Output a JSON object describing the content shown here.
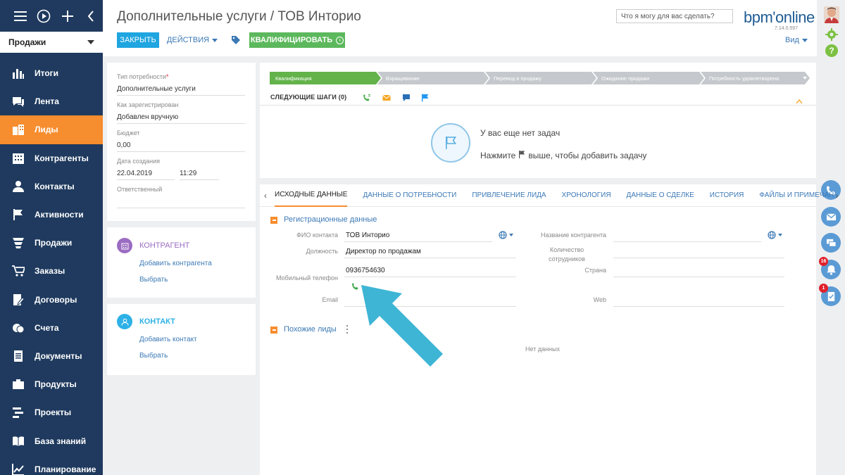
{
  "sidebar": {
    "workplace": "Продажи",
    "items": [
      {
        "label": "Итоги",
        "icon": "dashboard-icon"
      },
      {
        "label": "Лента",
        "icon": "feed-icon"
      },
      {
        "label": "Лиды",
        "icon": "leads-icon",
        "active": true
      },
      {
        "label": "Контрагенты",
        "icon": "accounts-icon"
      },
      {
        "label": "Контакты",
        "icon": "contacts-icon"
      },
      {
        "label": "Активности",
        "icon": "activities-icon"
      },
      {
        "label": "Продажи",
        "icon": "sales-icon"
      },
      {
        "label": "Заказы",
        "icon": "orders-icon"
      },
      {
        "label": "Договоры",
        "icon": "contracts-icon"
      },
      {
        "label": "Счета",
        "icon": "invoices-icon"
      },
      {
        "label": "Документы",
        "icon": "documents-icon"
      },
      {
        "label": "Продукты",
        "icon": "products-icon"
      },
      {
        "label": "Проекты",
        "icon": "projects-icon"
      },
      {
        "label": "База знаний",
        "icon": "knowledge-base-icon"
      },
      {
        "label": "Планирование",
        "icon": "planning-icon"
      }
    ]
  },
  "header": {
    "title": "Дополнительные услуги / ТОВ Инторио",
    "close_label": "Закрыть",
    "actions_label": "Действия",
    "qualify_label": "Квалифицировать",
    "search_placeholder": "Что я могу для вас сделать?",
    "logo": "bpm'online",
    "version": "7.14.0.597",
    "view_label": "Вид"
  },
  "info_card": {
    "need_type_label": "Тип потребности",
    "need_type_value": "Дополнительные услуги",
    "registered_label": "Как зарегистрирован",
    "registered_value": "Добавлен вручную",
    "budget_label": "Бюджет",
    "budget_value": "0,00",
    "created_label": "Дата создания",
    "created_date": "22.04.2019",
    "created_time": "11:29",
    "owner_label": "Ответственный",
    "owner_value": ""
  },
  "account_card": {
    "title": "КОНТРАГЕНТ",
    "add_link": "Добавить контрагента",
    "select_link": "Выбрать"
  },
  "contact_card": {
    "title": "КОНТАКТ",
    "add_link": "Добавить контакт",
    "select_link": "Выбрать"
  },
  "stages": [
    {
      "label": "Квалификация",
      "active": true
    },
    {
      "label": "Взращивание",
      "active": false
    },
    {
      "label": "Перевод в продажу",
      "active": false
    },
    {
      "label": "Ожидание продажи",
      "active": false
    },
    {
      "label": "Потребность удовлетворена",
      "active": false
    }
  ],
  "next_steps": {
    "label": "СЛЕДУЮЩИЕ ШАГИ (0)",
    "empty_title": "У вас еще нет задач",
    "empty_hint_before": "Нажмите",
    "empty_hint_after": "выше, чтобы добавить задачу"
  },
  "tabs": [
    {
      "label": "ИСХОДНЫЕ ДАННЫЕ",
      "active": true
    },
    {
      "label": "ДАННЫЕ О ПОТРЕБНОСТИ"
    },
    {
      "label": "ПРИВЛЕЧЕНИЕ ЛИДА"
    },
    {
      "label": "ХРОНОЛОГИЯ"
    },
    {
      "label": "ДАННЫЕ О СДЕЛКЕ"
    },
    {
      "label": "ИСТОРИЯ"
    },
    {
      "label": "ФАЙЛЫ И ПРИМЕЧАН"
    }
  ],
  "registration": {
    "group_title": "Регистрационные данные",
    "contact_name_label": "ФИО контакта",
    "contact_name_value": "ТОВ Инторио",
    "job_title_label": "Должность",
    "job_title_value": "Директор по продажам",
    "mobile_label": "Мобильный телефон",
    "mobile_value": "0936754630",
    "email_label": "Email",
    "email_value": "",
    "account_name_label": "Название контрагента",
    "account_name_value": "",
    "employees_label_1": "Количество",
    "employees_label_2": "сотрудников",
    "employees_value": "",
    "country_label": "Страна",
    "country_value": "",
    "web_label": "Web",
    "web_value": ""
  },
  "similar": {
    "group_title": "Похожие лиды",
    "no_data": "Нет данных"
  },
  "rail": {
    "notifications_count": "16",
    "tasks_count": "1"
  },
  "colors": {
    "sidebar": "#1f3a5e",
    "accent_orange": "#f68d2e",
    "primary_blue": "#1fa5e0",
    "success_green": "#5cb85c",
    "link": "#3c79b6",
    "arrow": "#3fb5d5"
  }
}
